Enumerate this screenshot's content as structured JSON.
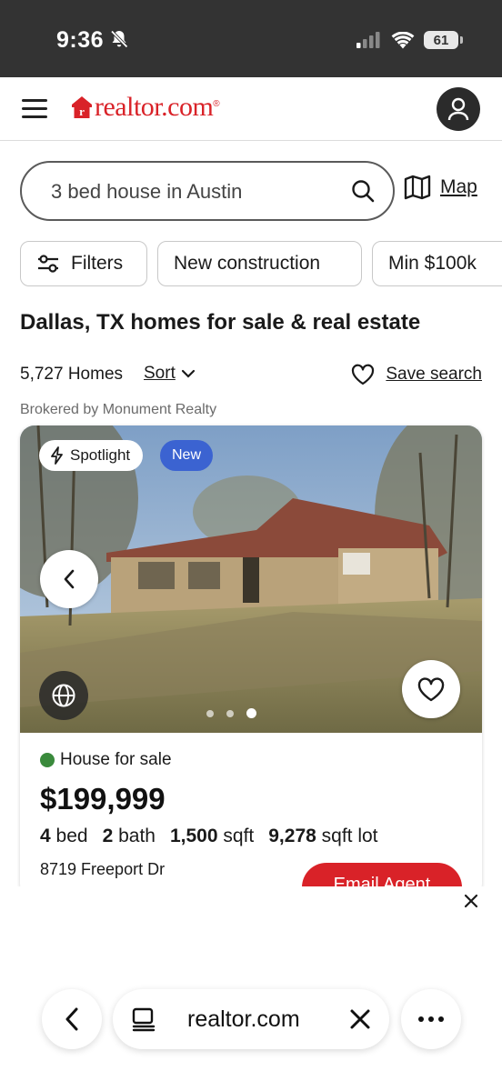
{
  "status_bar": {
    "time": "9:36",
    "battery": "61"
  },
  "header": {
    "logo_text": "realtor.com",
    "logo_registered": "®"
  },
  "search": {
    "value": "3 bed house in Austin",
    "map_label": "Map"
  },
  "filters": [
    {
      "label": "Filters"
    },
    {
      "label": "New construction"
    },
    {
      "label": "Min $100k"
    }
  ],
  "page_title": "Dallas, TX homes for sale & real estate",
  "results": {
    "count": "5,727 Homes",
    "sort_label": "Sort",
    "save_search_label": "Save search"
  },
  "brokered_by": "Brokered by Monument Realty",
  "listing": {
    "badge_spotlight": "Spotlight",
    "badge_new": "New",
    "status": "House for sale",
    "status_color": "#3a8a3c",
    "price": "$199,999",
    "beds": "4",
    "beds_label": "bed",
    "baths": "2",
    "baths_label": "bath",
    "sqft": "1,500",
    "sqft_label": "sqft",
    "lot": "9,278",
    "lot_label": "sqft lot",
    "address": "8719 Freeport Dr",
    "email_agent_label": "Email Agent",
    "photo_count": 3,
    "photo_active_index": 2
  },
  "browser": {
    "url": "realtor.com"
  },
  "colors": {
    "brand_red": "#d92228",
    "new_badge_blue": "#3b63d1"
  }
}
